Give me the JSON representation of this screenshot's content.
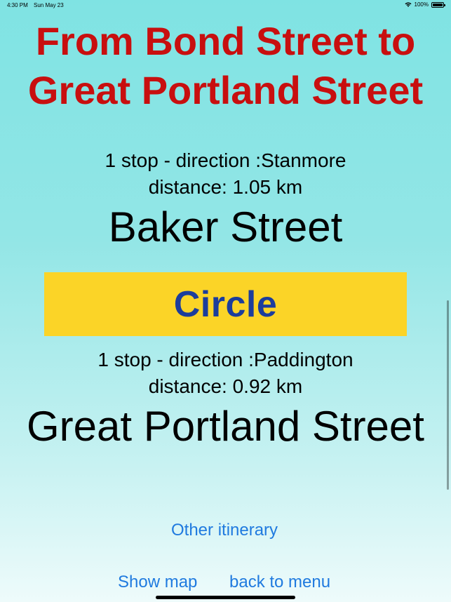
{
  "status_bar": {
    "time": "4:30 PM",
    "date": "Sun May 23",
    "battery": "100%",
    "icons": [
      "wifi-icon",
      "battery-icon"
    ]
  },
  "title": {
    "line1": "From Bond Street to",
    "line2": "Great Portland Street"
  },
  "legs": [
    {
      "stops_direction": "1 stop - direction :Stanmore",
      "distance": "distance: 1.05 km",
      "station": "Baker Street"
    },
    {
      "line_name": "Circle",
      "stops_direction": "1 stop - direction :Paddington",
      "distance": "distance: 0.92 km",
      "station": "Great Portland Street"
    }
  ],
  "actions": {
    "other_itinerary": "Other itinerary",
    "show_map": "Show map",
    "back_to_menu": "back to menu"
  },
  "colors": {
    "title": "#c80f0f",
    "link": "#1f7adf",
    "circle_line_bg": "#fbd427",
    "circle_line_text": "#1c3d9c"
  }
}
